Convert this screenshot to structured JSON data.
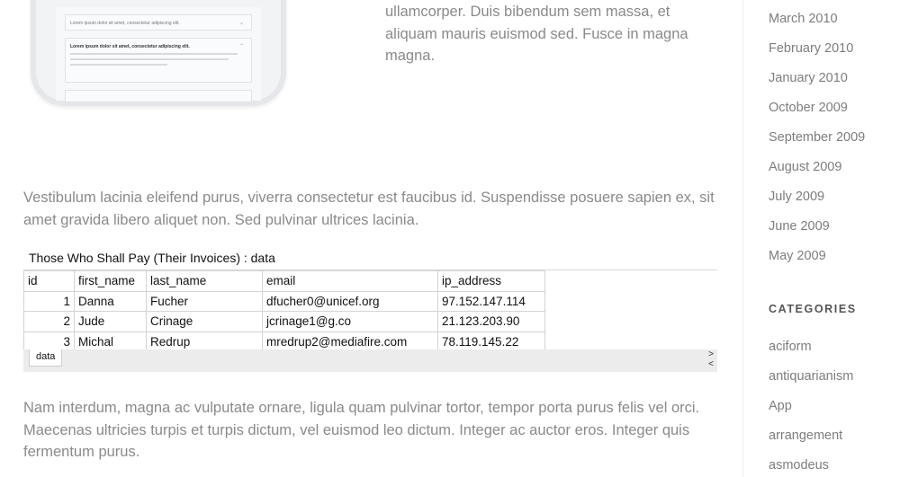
{
  "phone_mockup": {
    "rows": [
      {
        "title": "Lorem ipsum dolor sit amet, consectetur adipiscing elit.",
        "expanded": false
      },
      {
        "title": "Lorem ipsum dolor sit amet, consectetur adipiscing elit.",
        "expanded": true
      }
    ]
  },
  "content": {
    "top_paragraph": "ullamcorper. Duis bibendum sem massa, et aliquam mauris euismod sed. Fusce in magna magna.",
    "paragraph1": "Vestibulum lacinia eleifend purus, viverra consectetur est faucibus id. Suspendisse posuere sapien ex, sit amet gravida libero aliquet non. Sed pulvinar ultrices lacinia.",
    "paragraph2": "Nam interdum, magna ac vulputate ornare, ligula quam pulvinar tortor, tempor porta purus felis vel orci. Maecenas ultricies turpis et turpis dictum, vel euismod leo dictum. Integer ac auctor eros. Integer quis fermentum purus."
  },
  "data_table": {
    "caption": "Those Who Shall Pay (Their Invoices) : data",
    "columns": [
      "id",
      "first_name",
      "last_name",
      "email",
      "ip_address"
    ],
    "rows": [
      [
        "1",
        "Danna",
        "Fucher",
        "dfucher0@unicef.org",
        "97.152.147.114"
      ],
      [
        "2",
        "Jude",
        "Crinage",
        "jcrinage1@g.co",
        "21.123.203.90"
      ],
      [
        "3",
        "Michal",
        "Redrup",
        "mredrup2@mediafire.com",
        "78.119.145.22"
      ]
    ],
    "sheet_tab": "data",
    "nav_next": ">",
    "nav_prev": "<"
  },
  "sidebar": {
    "archives": [
      "March 2010",
      "February 2010",
      "January 2010",
      "October 2009",
      "September 2009",
      "August 2009",
      "July 2009",
      "June 2009",
      "May 2009"
    ],
    "categories_heading": "CATEGORIES",
    "categories": [
      "aciform",
      "antiquarianism",
      "App",
      "arrangement",
      "asmodeus"
    ]
  }
}
